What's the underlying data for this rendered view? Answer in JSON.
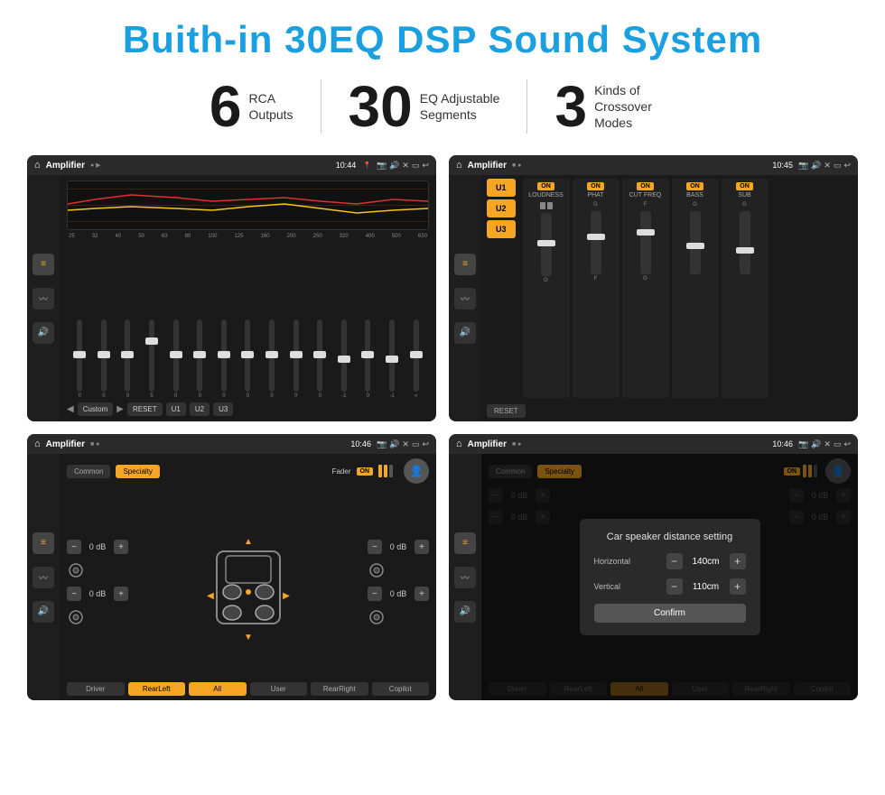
{
  "page": {
    "title": "Buith-in 30EQ DSP Sound System",
    "stats": [
      {
        "number": "6",
        "label": "RCA\nOutputs"
      },
      {
        "number": "30",
        "label": "EQ Adjustable\nSegments"
      },
      {
        "number": "3",
        "label": "Kinds of\nCrossover Modes"
      }
    ]
  },
  "screens": {
    "eq": {
      "topbar": {
        "title": "Amplifier",
        "time": "10:44"
      },
      "freqs": [
        "25",
        "32",
        "40",
        "50",
        "63",
        "80",
        "100",
        "125",
        "160",
        "200",
        "250",
        "320",
        "400",
        "500",
        "630"
      ],
      "values": [
        "0",
        "0",
        "0",
        "5",
        "0",
        "0",
        "0",
        "0",
        "0",
        "0",
        "0",
        "-1",
        "0",
        "-1"
      ],
      "buttons": [
        "Custom",
        "RESET",
        "U1",
        "U2",
        "U3"
      ]
    },
    "amp": {
      "topbar": {
        "title": "Amplifier",
        "time": "10:45"
      },
      "presets": [
        "U1",
        "U2",
        "U3"
      ],
      "channels": [
        {
          "label": "LOUDNESS",
          "on": true
        },
        {
          "label": "PHAT",
          "on": true
        },
        {
          "label": "CUT FREQ",
          "on": true
        },
        {
          "label": "BASS",
          "on": true
        },
        {
          "label": "SUB",
          "on": true
        }
      ],
      "resetLabel": "RESET"
    },
    "crossover": {
      "topbar": {
        "title": "Amplifier",
        "time": "10:46"
      },
      "modes": [
        "Common",
        "Specialty"
      ],
      "faderLabel": "Fader",
      "controls": {
        "topLeft": "0 dB",
        "topRight": "0 dB",
        "bottomLeft": "0 dB",
        "bottomRight": "0 dB"
      },
      "buttons": [
        "Driver",
        "RearLeft",
        "All",
        "User",
        "RearRight",
        "Copilot"
      ]
    },
    "dialog": {
      "topbar": {
        "title": "Amplifier",
        "time": "10:46"
      },
      "modes": [
        "Common",
        "Specialty"
      ],
      "dialogTitle": "Car speaker distance setting",
      "horizontal": {
        "label": "Horizontal",
        "value": "140cm"
      },
      "vertical": {
        "label": "Vertical",
        "value": "110cm"
      },
      "confirmLabel": "Confirm",
      "sideControls": {
        "topLeft": "0 dB",
        "bottomLeft": "0 dB"
      },
      "buttons": [
        "Driver",
        "RearLeft",
        "All",
        "User",
        "RearRight",
        "Copilot"
      ]
    }
  }
}
